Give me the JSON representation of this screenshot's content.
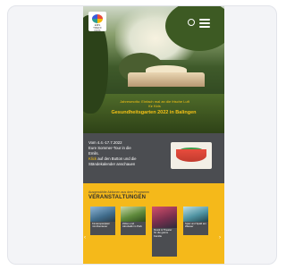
{
  "hero": {
    "subtitle": "Jahresmotto: Einfach mal an die frische Luft",
    "line2": "für Kids",
    "title": "Gesundheitsgarten 2022 in Balingen"
  },
  "logo": {
    "text": "EMS TREFF KIDS"
  },
  "info": {
    "line1": "Vom 4.4.-17.7.2022",
    "line2": "Eure Sommer-Tour in die",
    "line3": "Emils.",
    "highlight": "Klick",
    "line4": "auf den Button und die",
    "line5": "Ständekalender anschauen"
  },
  "section": {
    "kicker": "Ausgewählte Aktionen aus dem Programm",
    "title": "VERANSTALTUNGEN"
  },
  "tiles": [
    {
      "caption": "Kinderspielplatz mit Abenteuer"
    },
    {
      "caption": "Zirkus und Akrobatik im Park"
    },
    {
      "caption": "Musik & Theater für die ganze Familie"
    },
    {
      "caption": "Spiel und Spaß am Wasser"
    }
  ],
  "colors": {
    "accent": "#f5b91a",
    "dark": "#4b4d51"
  }
}
